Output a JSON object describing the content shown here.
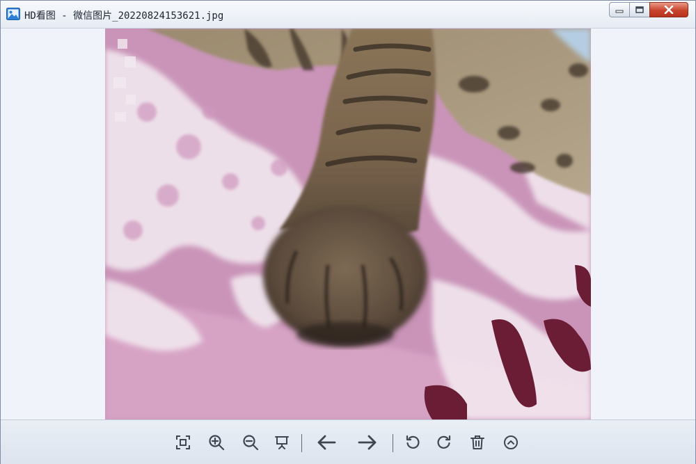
{
  "window": {
    "title": "HD看图 - 微信图片_20220824153621.jpg",
    "controls": [
      "minimize",
      "maximize",
      "close"
    ]
  },
  "image": {
    "filename": "微信图片_20220824153621.jpg",
    "description": "cat paw on pink blanket"
  },
  "toolbar": {
    "buttons": [
      {
        "name": "fit-screen",
        "icon": "fit-screen-icon"
      },
      {
        "name": "zoom-in",
        "icon": "zoom-in-icon"
      },
      {
        "name": "zoom-out",
        "icon": "zoom-out-icon"
      },
      {
        "name": "slideshow",
        "icon": "presentation-icon"
      },
      {
        "name": "previous",
        "icon": "arrow-left-icon"
      },
      {
        "name": "next",
        "icon": "arrow-right-icon"
      },
      {
        "name": "rotate-left",
        "icon": "rotate-left-icon"
      },
      {
        "name": "rotate-right",
        "icon": "rotate-right-icon"
      },
      {
        "name": "delete",
        "icon": "trash-icon"
      },
      {
        "name": "more",
        "icon": "chevron-up-circle-icon"
      }
    ]
  },
  "colors": {
    "icon": "#3f4652",
    "close_button": "#c8432c",
    "blanket_pink": "#c98fb6",
    "blanket_white": "#efe4ec",
    "blanket_dark": "#6d1f36",
    "fur": "#7e6a52"
  }
}
